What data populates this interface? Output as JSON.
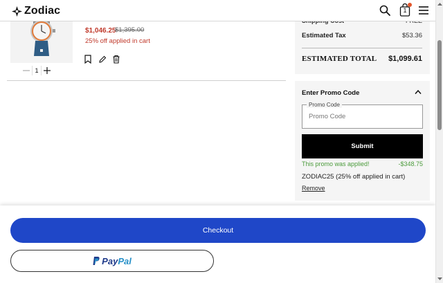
{
  "header": {
    "brand": "Zodiac",
    "bag_count": "1",
    "icons": [
      "search-icon",
      "shopping-bag-icon",
      "menu-icon"
    ],
    "accent_color": "#e2552b"
  },
  "product": {
    "sale_price": "$1,046.25",
    "original_price": "$1,395.00",
    "promo_note": "25% off applied in cart",
    "quantity": "1",
    "action_icons": [
      "bookmark-icon",
      "pencil-icon",
      "trash-icon"
    ]
  },
  "summary": {
    "shipping_label": "Shipping Cost",
    "shipping_value": "FREE",
    "tax_label": "Estimated Tax",
    "tax_value": "$53.36",
    "total_label": "ESTIMATED TOTAL",
    "total_value": "$1,099.61"
  },
  "promo": {
    "heading": "Enter Promo Code",
    "field_label": "Promo Code",
    "field_placeholder": "Promo Code",
    "field_value": "",
    "submit_label": "Submit",
    "applied_message": "This promo was applied!",
    "applied_amount": "-$348.75",
    "code_description": "ZODIAC25 (25% off applied in cart)",
    "remove_label": "Remove",
    "success_color": "#4a9a3a"
  },
  "actions": {
    "checkout_label": "Checkout",
    "checkout_color": "#1f47c8",
    "paypal_pay": "Pay",
    "paypal_pal": "Pal"
  }
}
